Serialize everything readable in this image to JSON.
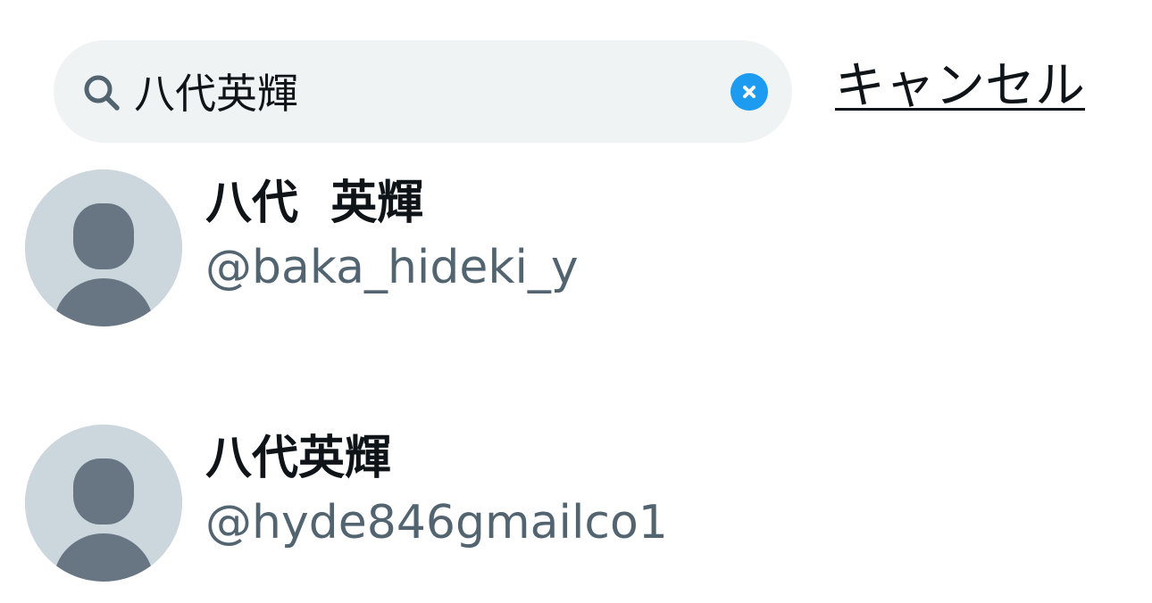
{
  "search": {
    "value": "八代英輝",
    "cancel_label": "キャンセル"
  },
  "results": [
    {
      "display_name": "八代  英輝",
      "handle": "@baka_hideki_y"
    },
    {
      "display_name": "八代英輝",
      "handle": "@hyde846gmailco1"
    }
  ],
  "colors": {
    "accent": "#1d9bf0",
    "search_bg": "#eff3f4",
    "avatar_bg": "#ccd6dd",
    "avatar_figure": "#687684",
    "primary_text": "#0f1419",
    "secondary_text": "#536471"
  },
  "icons": {
    "search": "magnifier-icon",
    "clear": "clear-x-icon",
    "avatar": "default-profile-icon"
  }
}
